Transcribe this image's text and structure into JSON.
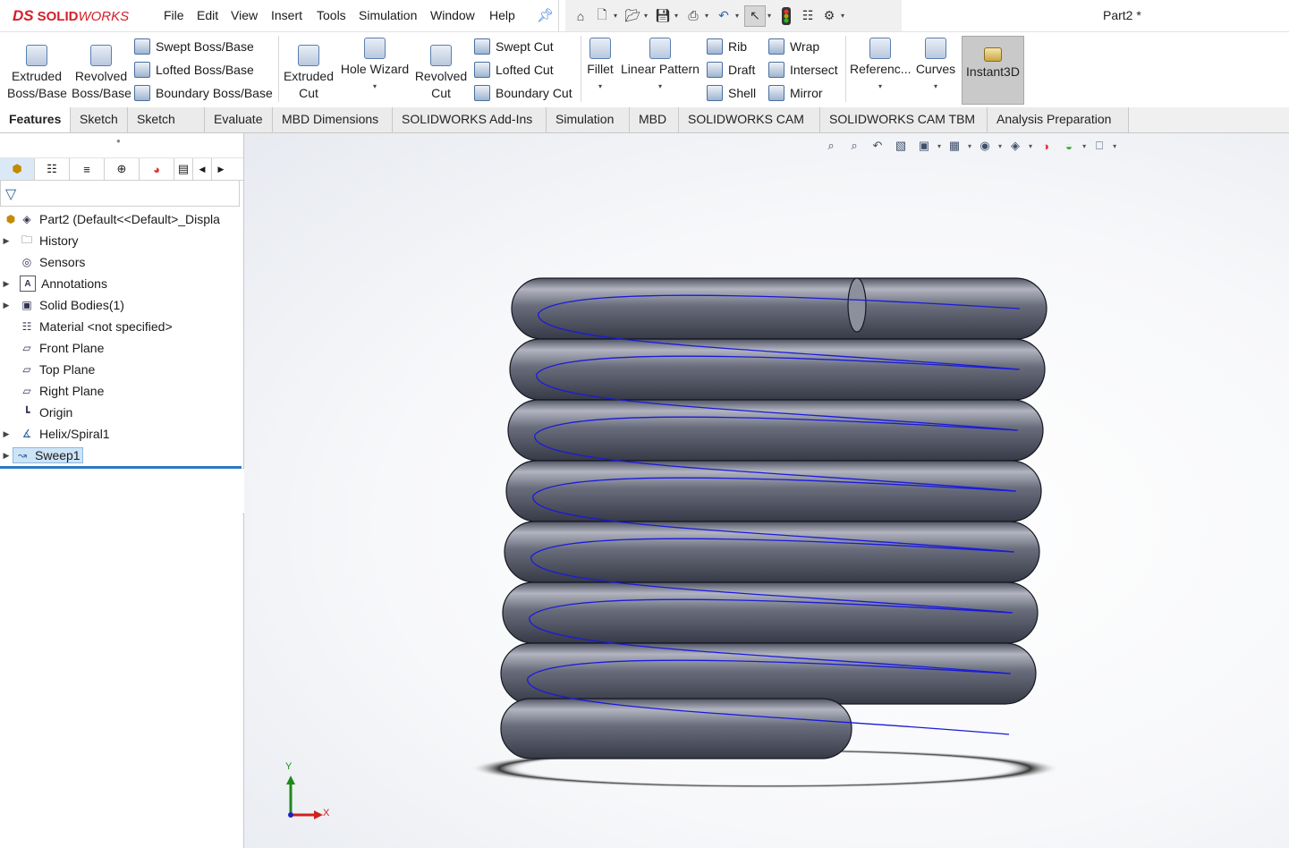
{
  "app": {
    "logo_prefix": "DS",
    "logo_name": "SOLID",
    "logo_name_italic": "WORKS",
    "document_title": "Part2 *"
  },
  "menu": [
    "File",
    "Edit",
    "View",
    "Insert",
    "Tools",
    "Simulation",
    "Window",
    "Help"
  ],
  "quick_access_icons": [
    "home-icon",
    "new-document-icon",
    "open-folder-icon",
    "save-icon",
    "print-icon",
    "undo-icon",
    "select-cursor-icon",
    "rebuild-traffic-light-icon",
    "file-properties-icon",
    "options-gear-icon"
  ],
  "command_manager": {
    "extruded_boss": [
      "Extruded",
      "Boss/Base"
    ],
    "revolved_boss": [
      "Revolved",
      "Boss/Base"
    ],
    "swept_boss": "Swept Boss/Base",
    "lofted_boss": "Lofted Boss/Base",
    "boundary_boss": "Boundary Boss/Base",
    "extruded_cut": [
      "Extruded",
      "Cut"
    ],
    "hole_wizard": "Hole Wizard",
    "revolved_cut": [
      "Revolved",
      "Cut"
    ],
    "swept_cut": "Swept Cut",
    "lofted_cut": "Lofted Cut",
    "boundary_cut": "Boundary Cut",
    "fillet": "Fillet",
    "linear_pattern": "Linear Pattern",
    "rib": "Rib",
    "draft": "Draft",
    "shell": "Shell",
    "wrap": "Wrap",
    "intersect": "Intersect",
    "mirror": "Mirror",
    "reference": "Referenc...",
    "curves": "Curves",
    "instant3d": "Instant3D"
  },
  "tabs": [
    "Features",
    "Sketch",
    "Sketch Ink",
    "Evaluate",
    "MBD Dimensions",
    "SOLIDWORKS Add-Ins",
    "Simulation",
    "MBD",
    "SOLIDWORKS CAM",
    "SOLIDWORKS CAM TBM",
    "Analysis Preparation"
  ],
  "active_tab": "Features",
  "feature_tree": {
    "root": "Part2  (Default<<Default>_Displa",
    "items": [
      {
        "label": "History",
        "icon": "history-folder-icon",
        "expandable": true
      },
      {
        "label": "Sensors",
        "icon": "sensors-icon",
        "expandable": false
      },
      {
        "label": "Annotations",
        "icon": "annotations-icon",
        "expandable": true
      },
      {
        "label": "Solid Bodies(1)",
        "icon": "solid-bodies-icon",
        "expandable": true
      },
      {
        "label": "Material <not specified>",
        "icon": "material-icon",
        "expandable": false
      },
      {
        "label": "Front Plane",
        "icon": "plane-icon",
        "expandable": false
      },
      {
        "label": "Top Plane",
        "icon": "plane-icon",
        "expandable": false
      },
      {
        "label": "Right Plane",
        "icon": "plane-icon",
        "expandable": false
      },
      {
        "label": "Origin",
        "icon": "origin-icon",
        "expandable": false
      },
      {
        "label": "Helix/Spiral1",
        "icon": "helix-icon",
        "expandable": true
      },
      {
        "label": "Sweep1",
        "icon": "sweep-icon",
        "expandable": true,
        "selected": true
      }
    ]
  },
  "triad": {
    "y_label": "Y",
    "x_label": "X"
  },
  "colors": {
    "brand_red": "#d4202a",
    "spring_body": "#5f6372",
    "helix_path": "#1a1adb",
    "selection": "#cde4f7",
    "pane_accent": "#2a7ac7"
  }
}
